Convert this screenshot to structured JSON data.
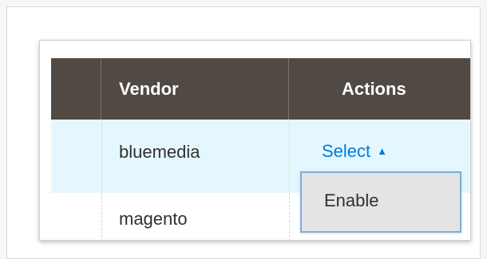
{
  "grid": {
    "columns": [
      "",
      "Vendor",
      "Actions"
    ],
    "rows": [
      {
        "vendor": "bluemedia",
        "action": "Select",
        "selected": true
      },
      {
        "vendor": "magento",
        "action": "",
        "selected": false
      }
    ]
  },
  "actions_menu": {
    "items": [
      "Enable"
    ]
  },
  "colors": {
    "header_bg": "#514943",
    "selected_row_bg": "#e5f7fe",
    "link": "#007bdb",
    "dropdown_bg": "#e4e4e4",
    "dropdown_border": "#7aaede"
  }
}
